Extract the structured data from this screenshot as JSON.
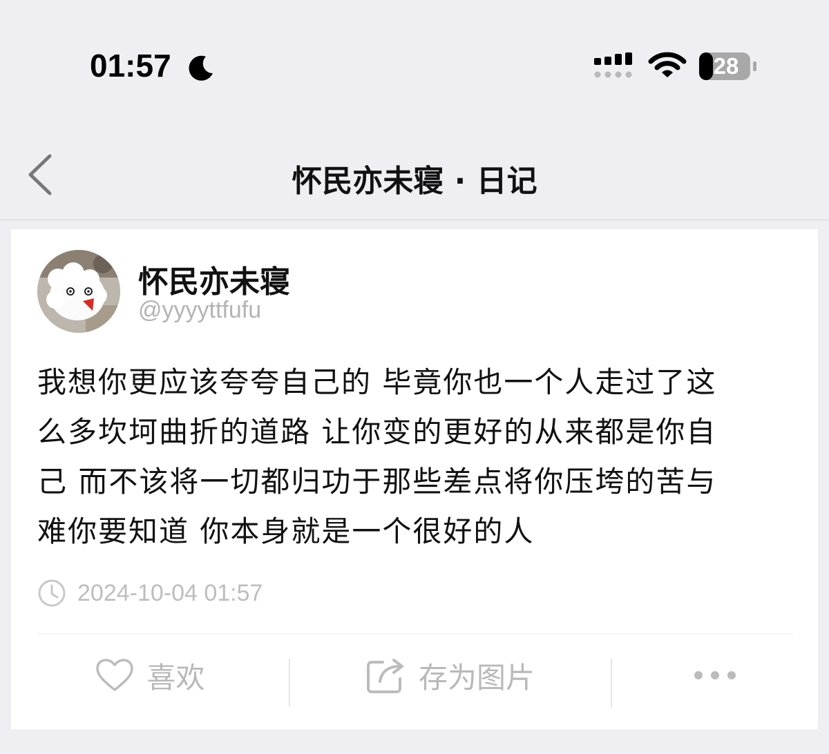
{
  "status_bar": {
    "time": "01:57",
    "battery_level": "28",
    "icons": [
      "moon-icon",
      "cellular-signal-icon",
      "wifi-icon",
      "battery-icon"
    ]
  },
  "nav": {
    "title": "怀民亦未寝 · 日记",
    "back_icon": "chevron-left-icon"
  },
  "post": {
    "username": "怀民亦未寝",
    "handle": "@yyyyttfufu",
    "body_lines": [
      "我想你更应该夸夸自己的 毕竟你也一个人走过了这",
      "么多坎坷曲折的道路 让你变的更好的从来都是你自",
      "己 而不该将一切都归功于那些差点将你压垮的苦与",
      "难你要知道 你本身就是一个很好的人"
    ],
    "timestamp": "2024-10-04 01:57"
  },
  "actions": {
    "like_label": "喜欢",
    "save_label": "存为图片",
    "more_icon": "more-dots-icon"
  },
  "colors": {
    "background": "#efeef3",
    "card": "#ffffff",
    "muted_text": "#b9b9b9"
  }
}
